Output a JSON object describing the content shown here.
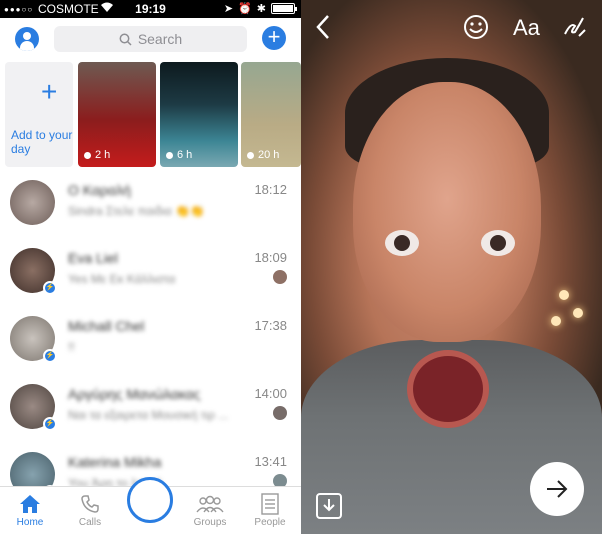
{
  "status_bar": {
    "carrier": "COSMOTE",
    "time": "19:19"
  },
  "search": {
    "placeholder": "Search"
  },
  "stories": {
    "add_label": "Add to your day",
    "items": [
      {
        "time": "2 h"
      },
      {
        "time": "6 h"
      },
      {
        "time": "20 h"
      }
    ]
  },
  "chats": [
    {
      "name": "Ο Καραλή",
      "preview": "Sindra Στελε παιδια 👏👏",
      "time": "18:12"
    },
    {
      "name": "Eva Liel",
      "preview": "Yes Με Εκ Κάλλιστα",
      "time": "18:09"
    },
    {
      "name": "Michall Chel",
      "preview": "!!",
      "time": "17:38"
    },
    {
      "name": "Αργύρης Μανώλακας",
      "preview": "Ναι τα εξαιρετα Μουσική τιρ ...",
      "time": "14:00"
    },
    {
      "name": "Katerina Mikha",
      "preview": "You Άρη το λεπτό",
      "time": "13:41"
    }
  ],
  "tabs": [
    {
      "label": "Home"
    },
    {
      "label": "Calls"
    },
    {
      "label": "Groups"
    },
    {
      "label": "People"
    }
  ],
  "editor": {
    "text_tool_label": "Aa"
  },
  "colors": {
    "accent": "#2a7de1",
    "tab_inactive": "#999999"
  }
}
